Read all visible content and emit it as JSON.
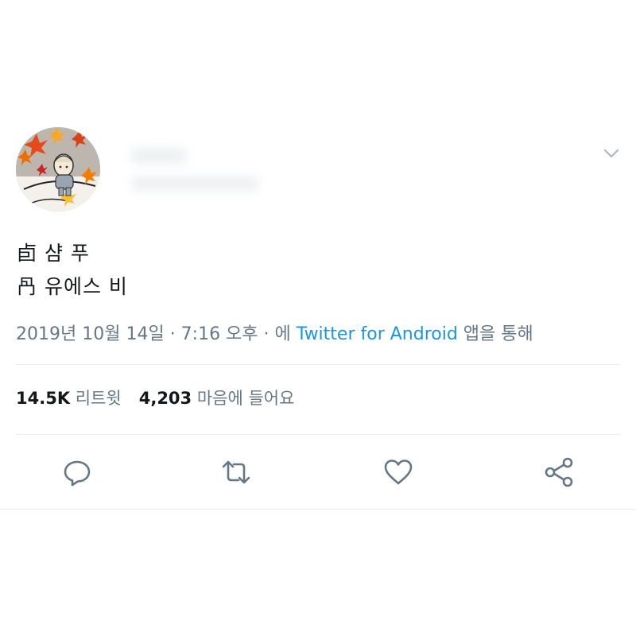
{
  "tweet": {
    "lines": [
      "卣 샴 푸",
      "冎 유에스 비"
    ],
    "meta": {
      "datetime": "2019년 10월 14일 · 7:16 오후 · 에 ",
      "source": "Twitter for Android",
      "suffix": " 앱을 통해"
    }
  },
  "stats": {
    "retweets_count": "14.5K",
    "retweets_label": " 리트윗",
    "likes_count": "4,203",
    "likes_label": " 마음에 들어요"
  },
  "icons": {
    "reply": "reply-icon",
    "retweet": "retweet-icon",
    "like": "heart-icon",
    "share": "share-icon",
    "menu": "chevron-down-icon"
  },
  "colors": {
    "text": "#14171a",
    "secondary": "#657786",
    "link": "#1b95e0",
    "divider": "#e6ecf0"
  }
}
